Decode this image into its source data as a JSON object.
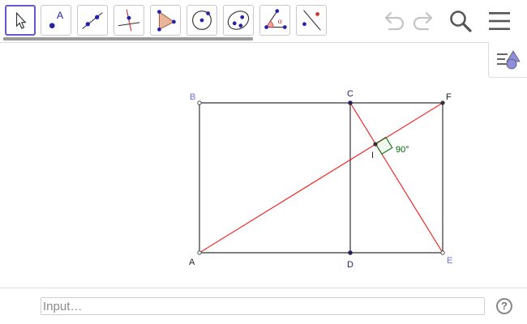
{
  "toolbar": {
    "tools": [
      {
        "name": "move",
        "icon": "cursor-arrow-icon",
        "selected": true
      },
      {
        "name": "point",
        "icon": "point-icon",
        "glyph": "A"
      },
      {
        "name": "line",
        "icon": "line-through-two-points-icon"
      },
      {
        "name": "perpendicular-line",
        "icon": "perpendicular-line-icon"
      },
      {
        "name": "polygon",
        "icon": "polygon-icon"
      },
      {
        "name": "circle",
        "icon": "circle-center-point-icon"
      },
      {
        "name": "conic",
        "icon": "ellipse-icon"
      },
      {
        "name": "angle",
        "icon": "angle-icon",
        "glyph": "α"
      },
      {
        "name": "reflect",
        "icon": "reflect-about-line-icon"
      }
    ],
    "undo_icon": "undo-icon",
    "redo_icon": "redo-icon",
    "search_icon": "search-icon",
    "menu_icon": "hamburger-menu-icon",
    "style_bar_icon": "style-bar-toggle-icon"
  },
  "graphics": {
    "points": {
      "A": "A",
      "B": "B",
      "C": "C",
      "D": "D",
      "E": "E",
      "F": "F",
      "I": "I"
    },
    "angle_label": "90°",
    "colors": {
      "segment": "#333333",
      "diagonal": "#ff0000",
      "angle": "#006400",
      "point_dark": "#1a1a7a",
      "label_blue": "#6b6be0",
      "label_dark": "#1a1a7a",
      "label_black": "#222222"
    }
  },
  "input": {
    "placeholder": "Input…",
    "value": ""
  },
  "help_label": "?"
}
